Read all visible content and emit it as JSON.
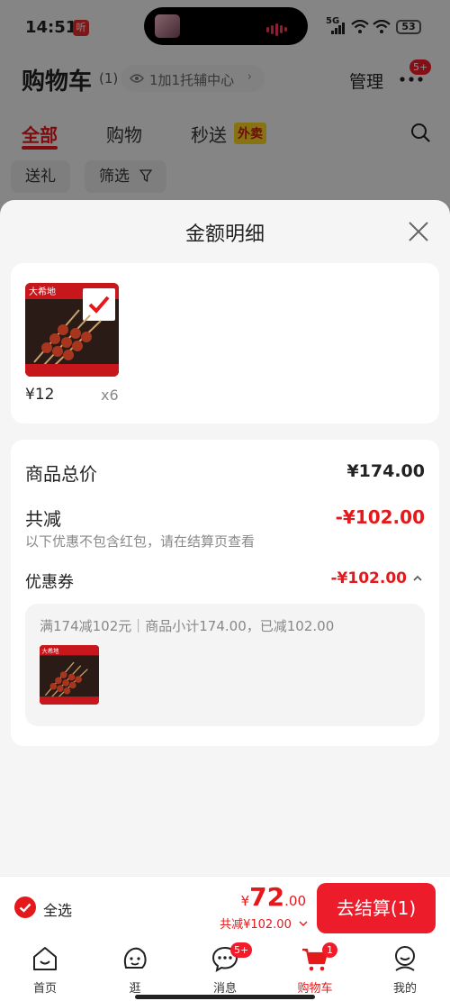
{
  "status_bar": {
    "time": "14:51",
    "app_badge": "听",
    "network": "5G",
    "battery": "53"
  },
  "header": {
    "title": "购物车",
    "count": "(1)",
    "assist_label": "1加1托辅中心",
    "manage_label": "管理",
    "more_badge": "5+"
  },
  "tabs": [
    {
      "label": "全部"
    },
    {
      "label": "购物"
    },
    {
      "label": "秒送"
    }
  ],
  "tab_tag": "外卖",
  "chips": {
    "gift": "送礼",
    "filter": "筛选"
  },
  "sheet": {
    "title": "金额明细",
    "product": {
      "price": "¥12",
      "quantity": "x6",
      "image_caption": "大希地"
    },
    "total_label": "商品总价",
    "total_value": "¥174.00",
    "discount_label": "共减",
    "discount_value": "-¥102.00",
    "discount_note": "以下优惠不包含红包，请在结算页查看",
    "coupon_label": "优惠券",
    "coupon_value": "-¥102.00",
    "coupon_desc": "满174减102元｜商品小计174.00，已减102.00"
  },
  "checkout": {
    "select_all": "全选",
    "currency": "¥",
    "total_int": "72",
    "total_dec": ".00",
    "saving": "共减¥102.00",
    "button": "去结算(1)"
  },
  "nav": {
    "items": [
      {
        "label": "首页"
      },
      {
        "label": "逛"
      },
      {
        "label": "消息",
        "badge": "5+"
      },
      {
        "label": "购物车",
        "badge": "1"
      },
      {
        "label": "我的"
      }
    ]
  },
  "colors": {
    "accent": "#e4191c",
    "waimai_bg": "#f6d21f"
  }
}
